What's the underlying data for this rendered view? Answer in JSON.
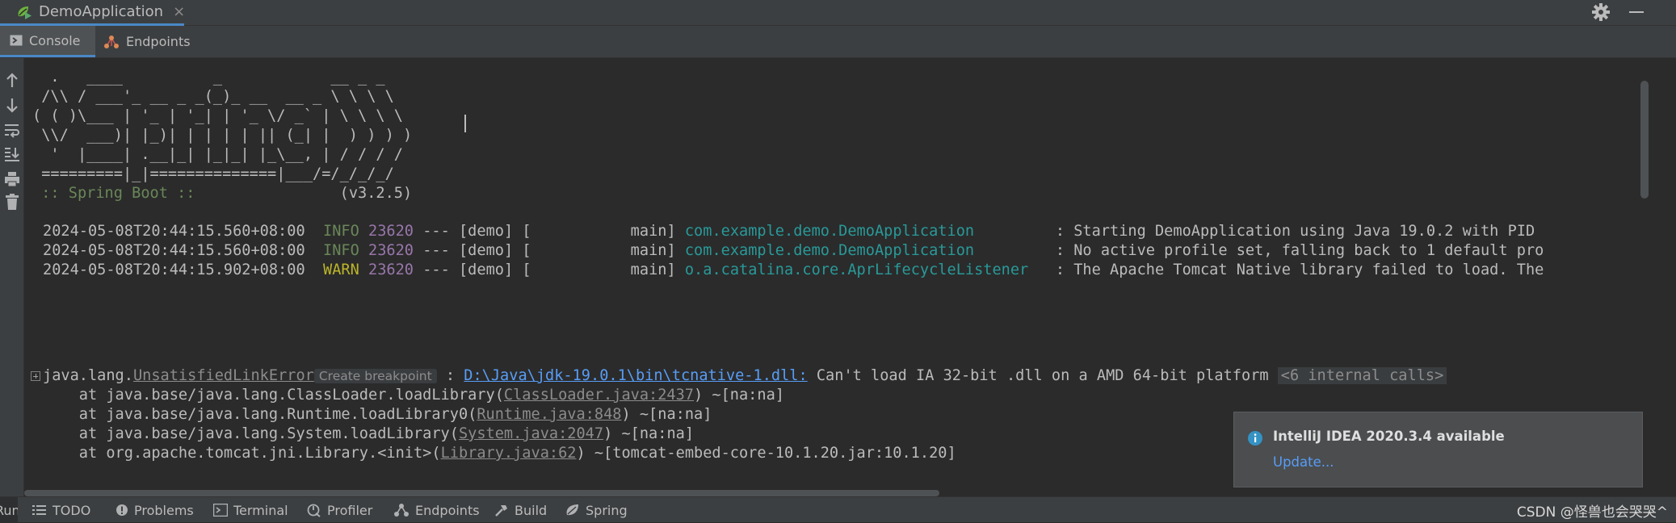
{
  "run_window": {
    "tab_label": "DemoApplication",
    "close_glyph": "×",
    "actions": [
      "gear-icon",
      "minimize-icon"
    ]
  },
  "sub_tabs": [
    {
      "label": "Console",
      "icon": "console-icon"
    },
    {
      "label": "Endpoints",
      "icon": "endpoints-icon"
    }
  ],
  "left_toolbar": [
    "up-arrow-icon",
    "down-arrow-icon",
    "soft-wrap-icon",
    "scroll-to-end-icon",
    "print-icon",
    "trash-icon"
  ],
  "console": {
    "banner": [
      "  .   ____          _            __ _ _",
      " /\\\\ / ___'_ __ _ _(_)_ __  __ _ \\ \\ \\ \\",
      "( ( )\\___ | '_ | '_| | '_ \\/ _` | \\ \\ \\ \\",
      " \\\\/  ___)| |_)| | | | | || (_| |  ) ) ) )",
      "  '  |____| .__|_| |_|_| |_\\__, | / / / /",
      " =========|_|==============|___/=/_/_/_/"
    ],
    "spring_boot_tag": " :: Spring Boot :: ",
    "spring_boot_version": "               (v3.2.5)",
    "log_lines": [
      {
        "timestamp": "2024-05-08T20:44:15.560+08:00",
        "level": "INFO",
        "pid": "23620",
        "middle": "--- [demo] [           main]",
        "logger": "com.example.demo.DemoApplication",
        "logger_pad": "         ",
        "message": ": Starting DemoApplication using Java 19.0.2 with PID"
      },
      {
        "timestamp": "2024-05-08T20:44:15.560+08:00",
        "level": "INFO",
        "pid": "23620",
        "middle": "--- [demo] [           main]",
        "logger": "com.example.demo.DemoApplication",
        "logger_pad": "         ",
        "message": ": No active profile set, falling back to 1 default pro"
      },
      {
        "timestamp": "2024-05-08T20:44:15.902+08:00",
        "level": "WARN",
        "pid": "23620",
        "middle": "--- [demo] [           main]",
        "logger": "o.a.catalina.core.AprLifecycleListener",
        "logger_pad": "   ",
        "message": ": The Apache Tomcat Native library failed to load. The"
      }
    ],
    "exception": {
      "prefix": "java.lang.",
      "class_link": "UnsatisfiedLinkError",
      "breakpoint_chip": "Create breakpoint",
      "colon": " : ",
      "path_link": "D:\\Java\\jdk-19.0.1\\bin\\tcnative-1.dll:",
      "message": " Can't load IA 32-bit .dll on a AMD 64-bit platform ",
      "internal_calls": "<6 internal calls>"
    },
    "stack_frames": [
      {
        "prefix": "    at java.base/java.lang.ClassLoader.loadLibrary(",
        "link": "ClassLoader.java:2437",
        "suffix": ") ~[na:na]"
      },
      {
        "prefix": "    at java.base/java.lang.Runtime.loadLibrary0(",
        "link": "Runtime.java:848",
        "suffix": ") ~[na:na]"
      },
      {
        "prefix": "    at java.base/java.lang.System.loadLibrary(",
        "link": "System.java:2047",
        "suffix": ") ~[na:na]"
      },
      {
        "prefix": "    at org.apache.tomcat.jni.Library.<init>(",
        "link": "Library.java:62",
        "suffix": ") ~[tomcat-embed-core-10.1.20.jar:10.1.20]"
      }
    ]
  },
  "notification": {
    "title": "IntelliJ IDEA 2020.3.4 available",
    "link": "Update...",
    "icon": "info-icon"
  },
  "bottom_bar": {
    "run_stub": "Run",
    "items": [
      {
        "label": "TODO",
        "icon": "todo-icon"
      },
      {
        "label": "Problems",
        "icon": "problems-icon"
      },
      {
        "label": "Terminal",
        "icon": "terminal-icon"
      },
      {
        "label": "Profiler",
        "icon": "profiler-icon"
      },
      {
        "label": "Endpoints",
        "icon": "endpoints-icon"
      },
      {
        "label": "Build",
        "icon": "build-icon"
      },
      {
        "label": "Spring",
        "icon": "spring-icon"
      }
    ],
    "watermark": "CSDN @怪兽也会哭哭^"
  },
  "colors": {
    "background": "#2b2b2b",
    "panel": "#3c3f41",
    "info_level": "#6a8759",
    "warn_level": "#bbb529",
    "pid": "#9876aa",
    "logger": "#299999",
    "link": "#589df6"
  }
}
